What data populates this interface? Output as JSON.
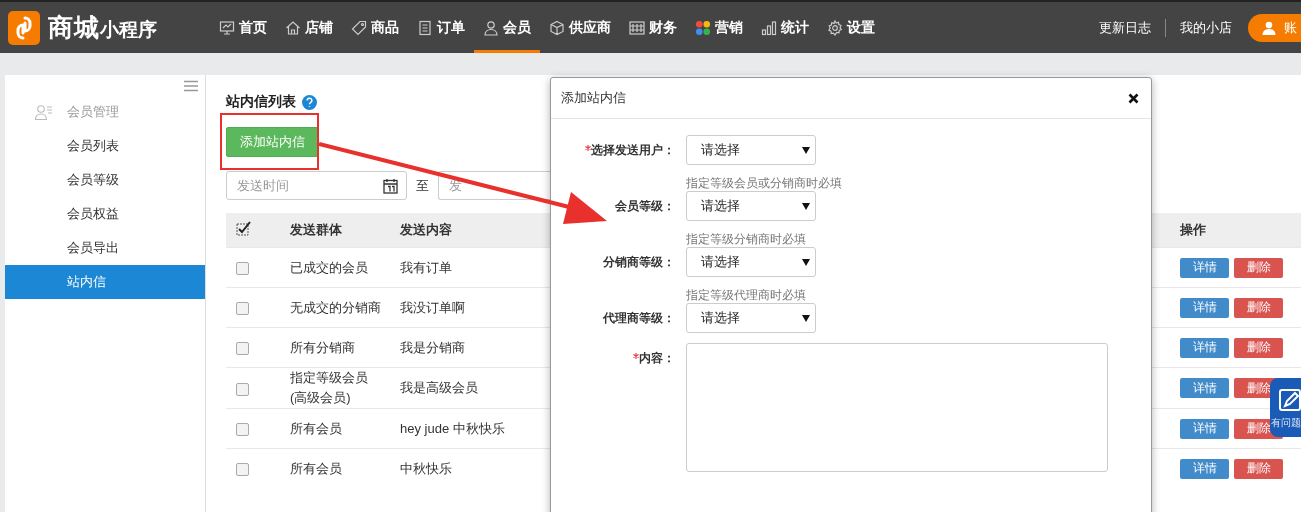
{
  "header": {
    "logo_main": "商城",
    "logo_sub": "小程序",
    "nav": [
      {
        "label": "首页",
        "selected": false
      },
      {
        "label": "店铺",
        "selected": false
      },
      {
        "label": "商品",
        "selected": false
      },
      {
        "label": "订单",
        "selected": false
      },
      {
        "label": "会员",
        "selected": true
      },
      {
        "label": "供应商",
        "selected": false
      },
      {
        "label": "财务",
        "selected": false
      },
      {
        "label": "营销",
        "selected": false
      },
      {
        "label": "统计",
        "selected": false
      },
      {
        "label": "设置",
        "selected": false
      }
    ],
    "links": [
      "更新日志",
      "我的小店"
    ],
    "account_button": "账"
  },
  "sidebar": {
    "section": "会员管理",
    "items": [
      {
        "label": "会员列表",
        "selected": false
      },
      {
        "label": "会员等级",
        "selected": false
      },
      {
        "label": "会员权益",
        "selected": false
      },
      {
        "label": "会员导出",
        "selected": false
      },
      {
        "label": "站内信",
        "selected": true
      }
    ]
  },
  "main": {
    "title": "站内信列表",
    "add_button": "添加站内信",
    "filter": {
      "start_placeholder": "发送时间",
      "separator": "至",
      "end_placeholder": "发"
    },
    "table": {
      "select_all_checked": true,
      "columns": [
        "发送群体",
        "发送内容",
        "操作"
      ],
      "rows": [
        {
          "group": "已成交的会员",
          "content": "我有订单",
          "checked": false,
          "actions": [
            "详情",
            "删除"
          ]
        },
        {
          "group": "无成交的分销商",
          "content": "我没订单啊",
          "checked": false,
          "actions": [
            "详情",
            "删除"
          ]
        },
        {
          "group": "所有分销商",
          "content": "我是分销商",
          "checked": false,
          "actions": [
            "详情",
            "删除"
          ]
        },
        {
          "group": "指定等级会员\n(高级会员)",
          "content": "我是高级会员",
          "checked": false,
          "actions": [
            "详情",
            "删除"
          ]
        },
        {
          "group": "所有会员",
          "content": "hey jude 中秋快乐",
          "checked": false,
          "actions": [
            "详情",
            "删除"
          ]
        },
        {
          "group": "所有会员",
          "content": "中秋快乐",
          "checked": false,
          "actions": [
            "详情",
            "删除"
          ]
        }
      ]
    }
  },
  "modal": {
    "title": "添加站内信",
    "fields": [
      {
        "kind": "select",
        "label": "选择发送用户：",
        "required": true,
        "value": "请选择"
      },
      {
        "kind": "select",
        "label": "会员等级：",
        "required": false,
        "value": "请选择",
        "hint": "指定等级会员或分销商时必填"
      },
      {
        "kind": "select",
        "label": "分销商等级：",
        "required": false,
        "value": "请选择",
        "hint": "指定等级分销商时必填"
      },
      {
        "kind": "select",
        "label": "代理商等级：",
        "required": false,
        "value": "请选择",
        "hint": "指定等级代理商时必填"
      },
      {
        "kind": "textarea",
        "label": "内容：",
        "required": true
      }
    ]
  },
  "help_widget": {
    "label": "有问题"
  }
}
